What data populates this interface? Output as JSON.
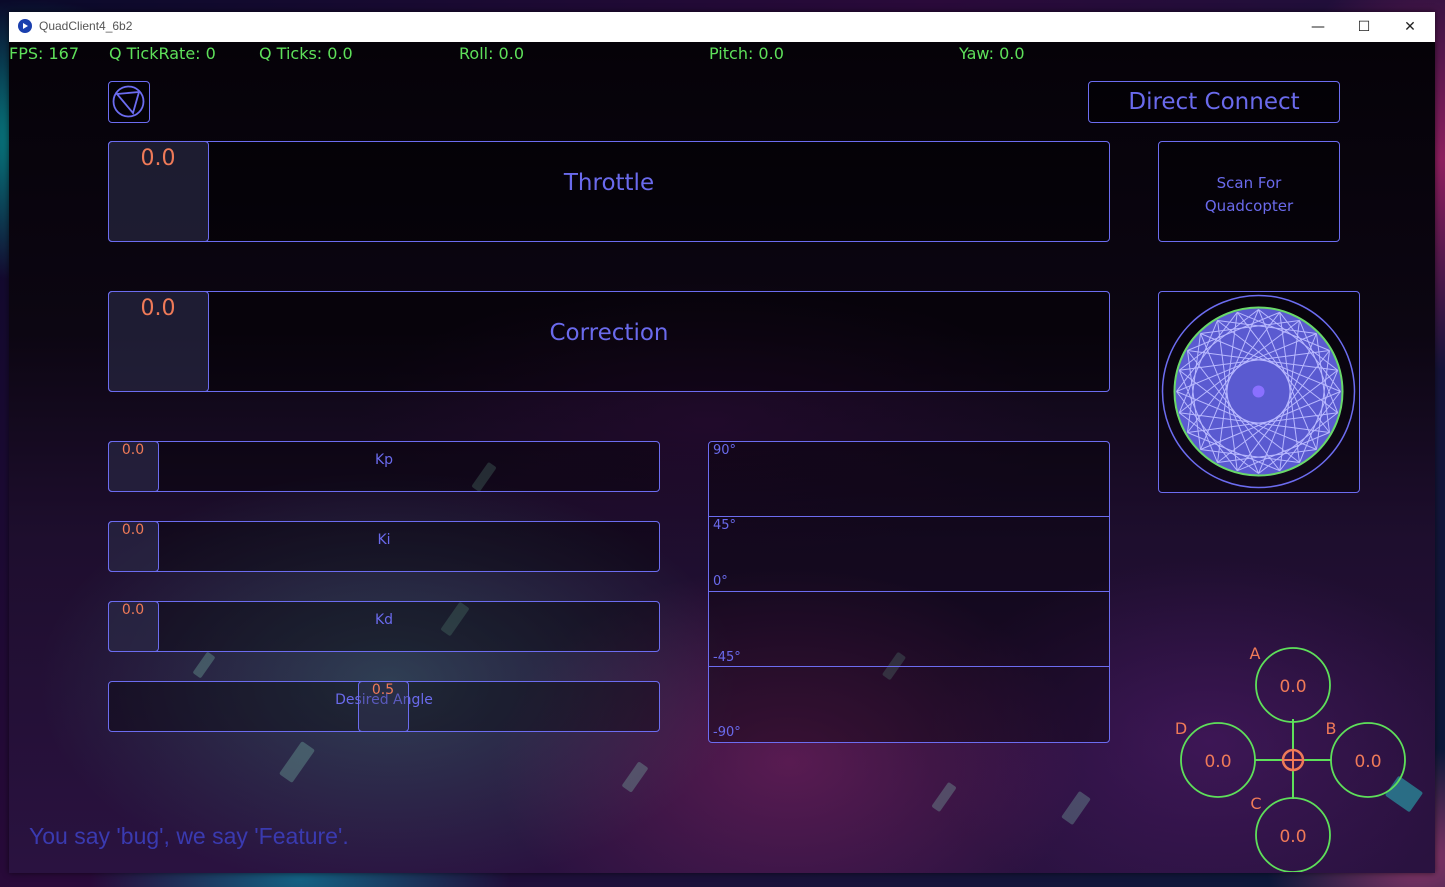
{
  "window": {
    "title": "QuadClient4_6b2",
    "minimize_glyph": "—",
    "maximize_glyph": "☐",
    "close_glyph": "✕",
    "app_icon": "play-circle-icon"
  },
  "stats": {
    "fps": "FPS: 167",
    "tick_rate": "Q TickRate: 0",
    "ticks": "Q Ticks: 0.0",
    "roll": "Roll: 0.0",
    "pitch": "Pitch: 0.0",
    "yaw": "Yaw: 0.0"
  },
  "buttons": {
    "direct_connect": "Direct Connect",
    "scan_line1": "Scan For",
    "scan_line2": "Quadcopter",
    "logo_icon": "quad-logo-icon"
  },
  "sliders": {
    "throttle": {
      "label": "Throttle",
      "value": "0.0"
    },
    "correction": {
      "label": "Correction",
      "value": "0.0"
    },
    "kp": {
      "label": "Kp",
      "value": "0.0"
    },
    "ki": {
      "label": "Ki",
      "value": "0.0"
    },
    "kd": {
      "label": "Kd",
      "value": "0.0"
    },
    "desired_angle": {
      "label": "Desired Angle",
      "value": "0.5",
      "level": 0.5
    }
  },
  "angle_graph": {
    "labels": [
      "90°",
      "45°",
      "0°",
      "-45°",
      "-90°"
    ]
  },
  "motors": {
    "a": {
      "label": "A",
      "value": "0.0"
    },
    "b": {
      "label": "B",
      "value": "0.0"
    },
    "c": {
      "label": "C",
      "value": "0.0"
    },
    "d": {
      "label": "D",
      "value": "0.0"
    }
  },
  "colors": {
    "accent": "#6c6cf0",
    "value": "#ef7a58",
    "stat": "#5ee05a",
    "motor": "#5ee05a"
  },
  "tagline": "You say 'bug', we say 'Feature'."
}
